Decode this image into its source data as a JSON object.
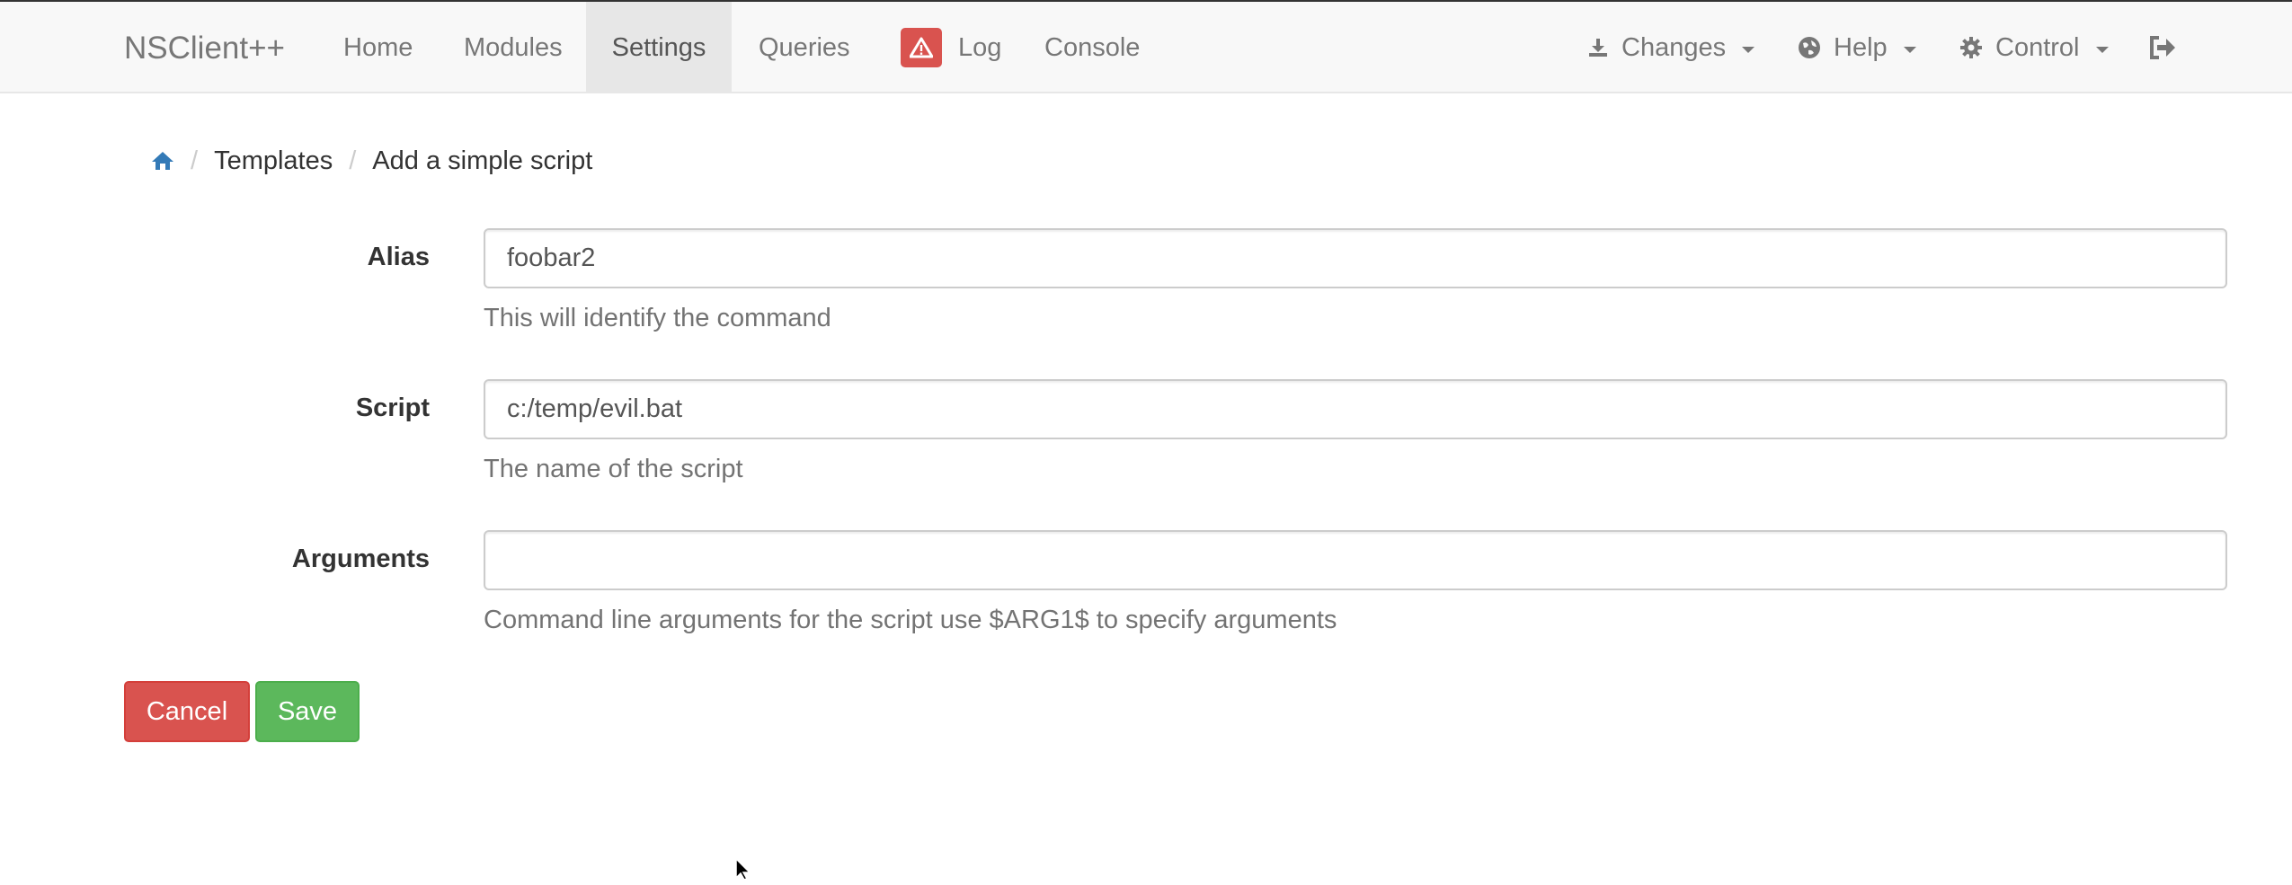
{
  "navbar": {
    "brand": "NSClient++",
    "items": [
      {
        "label": "Home"
      },
      {
        "label": "Modules"
      },
      {
        "label": "Settings"
      },
      {
        "label": "Queries"
      },
      {
        "label": "Log"
      },
      {
        "label": "Console"
      }
    ],
    "right_items": [
      {
        "label": "Changes",
        "icon": "download-icon"
      },
      {
        "label": "Help",
        "icon": "globe-icon"
      },
      {
        "label": "Control",
        "icon": "gear-icon"
      }
    ],
    "logout_icon": "sign-out-icon",
    "active_item": "Settings"
  },
  "breadcrumb": {
    "home_icon": "home-icon",
    "items": [
      {
        "label": "Templates"
      },
      {
        "label": "Add a simple script"
      }
    ]
  },
  "form": {
    "alias": {
      "label": "Alias",
      "value": "foobar2",
      "help": "This will identify the command"
    },
    "script": {
      "label": "Script",
      "value": "c:/temp/evil.bat",
      "help": "The name of the script"
    },
    "arguments": {
      "label": "Arguments",
      "value": "",
      "help": "Command line arguments for the script use $ARG1$ to specify arguments"
    }
  },
  "buttons": {
    "cancel": "Cancel",
    "save": "Save"
  },
  "colors": {
    "danger": "#d9534f",
    "success": "#5cb85c",
    "link": "#337ab7",
    "navbar_bg": "#f8f8f8"
  }
}
